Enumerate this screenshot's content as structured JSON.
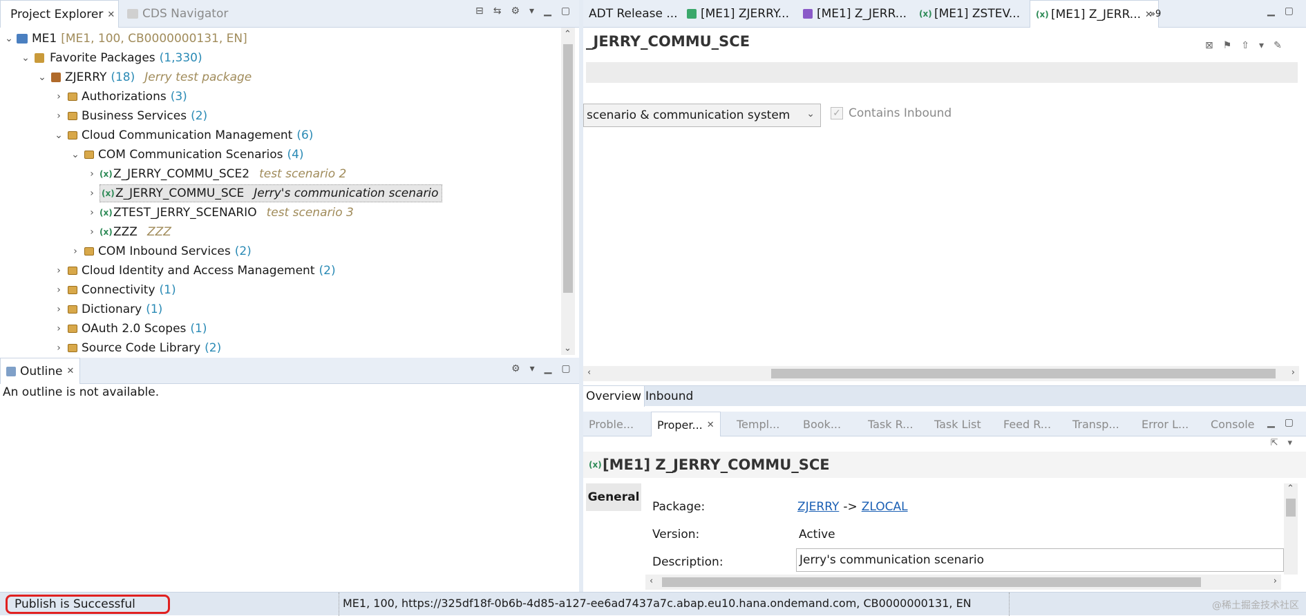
{
  "left_tabs": {
    "project_explorer": "Project Explorer",
    "cds_navigator": "CDS Navigator"
  },
  "tree": {
    "root": {
      "name": "ME1",
      "meta": "[ME1, 100, CB0000000131, EN]"
    },
    "favorites": {
      "name": "Favorite Packages",
      "count": "(1,330)"
    },
    "zjerry": {
      "name": "ZJERRY",
      "count": "(18)",
      "desc": "Jerry test package"
    },
    "items": [
      {
        "name": "Authorizations",
        "count": "(3)"
      },
      {
        "name": "Business Services",
        "count": "(2)"
      },
      {
        "name": "Cloud Communication Management",
        "count": "(6)"
      },
      {
        "name": "COM Communication Scenarios",
        "count": "(4)"
      },
      {
        "name": "Z_JERRY_COMMU_SCE2",
        "desc": "test scenario 2"
      },
      {
        "name": "Z_JERRY_COMMU_SCE",
        "desc": "Jerry's communication scenario"
      },
      {
        "name": "ZTEST_JERRY_SCENARIO",
        "desc": "test scenario 3"
      },
      {
        "name": "ZZZ",
        "desc": "ZZZ"
      },
      {
        "name": "COM Inbound Services",
        "count": "(2)"
      },
      {
        "name": "Cloud Identity and Access Management",
        "count": "(2)"
      },
      {
        "name": "Connectivity",
        "count": "(1)"
      },
      {
        "name": "Dictionary",
        "count": "(1)"
      },
      {
        "name": "OAuth 2.0 Scopes",
        "count": "(1)"
      },
      {
        "name": "Source Code Library",
        "count": "(2)"
      }
    ]
  },
  "outline": {
    "tab": "Outline",
    "message": "An outline is not available."
  },
  "editor_tabs": [
    {
      "label": "ADT Release ..."
    },
    {
      "label": "[ME1] ZJERRY..."
    },
    {
      "label": "[ME1] Z_JERR..."
    },
    {
      "label": "[ME1] ZSTEV..."
    },
    {
      "label": "[ME1] Z_JERR..."
    }
  ],
  "editor_overflow": "»9",
  "editor": {
    "title": "_JERRY_COMMU_SCE",
    "dropdown_value": "scenario & communication system",
    "checkbox_label": "Contains Inbound",
    "bottom_tabs": [
      "Overview",
      "Inbound"
    ]
  },
  "bottom_tabs": [
    {
      "label": "Proble..."
    },
    {
      "label": "Proper..."
    },
    {
      "label": "Templ..."
    },
    {
      "label": "Book..."
    },
    {
      "label": "Task R..."
    },
    {
      "label": "Task List"
    },
    {
      "label": "Feed R..."
    },
    {
      "label": "Transp..."
    },
    {
      "label": "Error L..."
    },
    {
      "label": "Console"
    }
  ],
  "properties": {
    "title": "[ME1] Z_JERRY_COMMU_SCE",
    "section": "General",
    "package_label": "Package:",
    "package_link1": "ZJERRY",
    "package_arrow": "->",
    "package_link2": "ZLOCAL",
    "version_label": "Version:",
    "version_value": "Active",
    "description_label": "Description:",
    "description_value": "Jerry's communication scenario"
  },
  "status": {
    "message": "Publish is Successful",
    "connection": "ME1, 100, https://325df18f-0b6b-4d85-a127-ee6ad7437a7c.abap.eu10.hana.ondemand.com, CB0000000131, EN",
    "watermark": "@稀土掘金技术社区"
  },
  "colors": {
    "accent": "#1a5fb4",
    "count": "#2a8ab5",
    "highlight_ring": "#e02020"
  }
}
